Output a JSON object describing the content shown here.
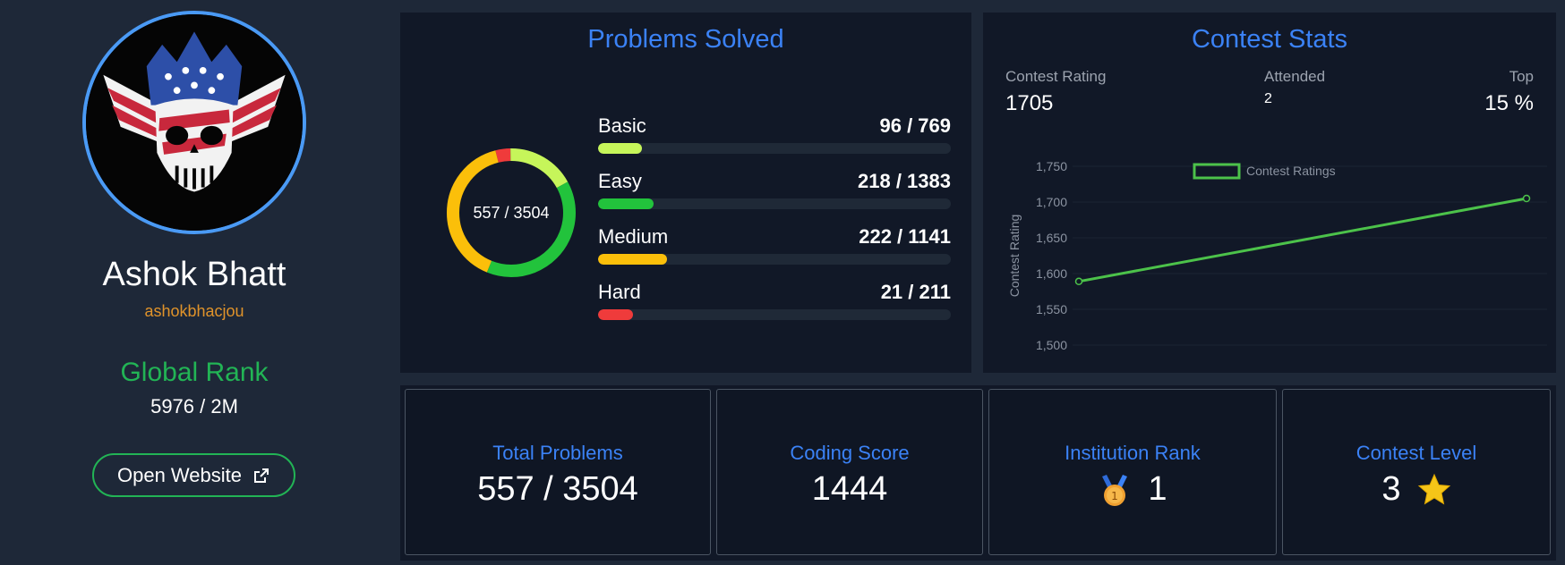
{
  "profile": {
    "name": "Ashok Bhatt",
    "username": "ashokbhacjou",
    "global_rank_label": "Global Rank",
    "global_rank_value": "5976 / 2M",
    "open_website_label": "Open Website"
  },
  "problems_solved": {
    "title": "Problems Solved",
    "total_label": "557 / 3504",
    "difficulties": [
      {
        "name": "Basic",
        "count": "96 / 769",
        "solved": 96,
        "total": 769,
        "color": "#c6f55a"
      },
      {
        "name": "Easy",
        "count": "218 / 1383",
        "solved": 218,
        "total": 1383,
        "color": "#22c33c"
      },
      {
        "name": "Medium",
        "count": "222 / 1141",
        "solved": 222,
        "total": 1141,
        "color": "#fbbf0a"
      },
      {
        "name": "Hard",
        "count": "21 / 211",
        "solved": 21,
        "total": 211,
        "color": "#ef3b3b"
      }
    ]
  },
  "contest_stats": {
    "title": "Contest Stats",
    "rating_label": "Contest Rating",
    "rating_value": "1705",
    "attended_label": "Attended",
    "attended_value": "2",
    "top_label": "Top",
    "top_value": "15 %"
  },
  "chart_data": {
    "type": "line",
    "series": [
      {
        "name": "Contest Ratings",
        "color": "#4cc24a",
        "x": [
          1,
          2
        ],
        "values": [
          1589,
          1705
        ]
      }
    ],
    "ylabel": "Contest Rating",
    "ylim": [
      1500,
      1750
    ],
    "yticks": [
      "1,500",
      "1,550",
      "1,600",
      "1,650",
      "1,700",
      "1,750"
    ],
    "legend": "top-center"
  },
  "summary_cards": {
    "total_problems_label": "Total Problems",
    "total_problems_value": "557 / 3504",
    "coding_score_label": "Coding Score",
    "coding_score_value": "1444",
    "institution_rank_label": "Institution Rank",
    "institution_rank_value": "1",
    "contest_level_label": "Contest Level",
    "contest_level_value": "3"
  },
  "icons": {
    "external_link": "external-link-icon",
    "medal": "medal-icon",
    "star": "star-icon"
  }
}
